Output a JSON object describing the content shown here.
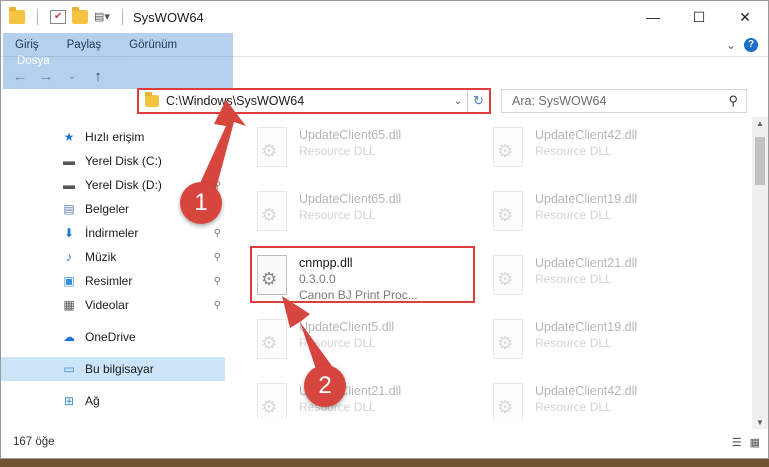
{
  "window": {
    "title": "SysWOW64",
    "controls": {
      "minimize": "—",
      "maximize": "☐",
      "close": "✕"
    }
  },
  "ribbon": {
    "tabs": [
      "Dosya",
      "Giriş",
      "Paylaş",
      "Görünüm"
    ],
    "expand": "⌄",
    "help": "?"
  },
  "navbar": {
    "back": "←",
    "forward": "→",
    "recent": "⌄",
    "up": "↑",
    "address": "C:\\Windows\\SysWOW64",
    "dropdown": "⌄",
    "refresh": "↻",
    "search_placeholder": "Ara: SysWOW64",
    "search_icon": "⚲"
  },
  "sidebar": {
    "items": [
      {
        "label": "Hızlı erişim",
        "icon": "star-icon",
        "glyph": "★",
        "color": "#1e73d6",
        "pinned": false
      },
      {
        "label": "Yerel Disk (C:)",
        "icon": "drive-icon",
        "glyph": "▬",
        "color": "#555555",
        "pinned": true
      },
      {
        "label": "Yerel Disk (D:)",
        "icon": "drive-icon",
        "glyph": "▬",
        "color": "#555555",
        "pinned": true
      },
      {
        "label": "Belgeler",
        "icon": "document-icon",
        "glyph": "▤",
        "color": "#5a7fb0",
        "pinned": true
      },
      {
        "label": "İndirmeler",
        "icon": "download-icon",
        "glyph": "⬇",
        "color": "#1e73d6",
        "pinned": true
      },
      {
        "label": "Müzik",
        "icon": "music-icon",
        "glyph": "♪",
        "color": "#1e73d6",
        "pinned": true
      },
      {
        "label": "Resimler",
        "icon": "pictures-icon",
        "glyph": "▣",
        "color": "#3a8dd8",
        "pinned": true
      },
      {
        "label": "Videolar",
        "icon": "video-icon",
        "glyph": "▦",
        "color": "#555555",
        "pinned": true
      }
    ],
    "onedrive": {
      "label": "OneDrive",
      "icon": "cloud-icon",
      "glyph": "☁",
      "color": "#1e73d6"
    },
    "computer": {
      "label": "Bu bilgisayar",
      "icon": "computer-icon",
      "glyph": "▭",
      "color": "#3a8dd8"
    },
    "network": {
      "label": "Ağ",
      "icon": "network-icon",
      "glyph": "⊞",
      "color": "#3a8dd8"
    },
    "pin_glyph": "📌"
  },
  "files": [
    {
      "name": "UpdateClient65.dll",
      "desc": "Resource DLL"
    },
    {
      "name": "UpdateClient42.dll",
      "desc": "Resource DLL"
    },
    {
      "name": "UpdateClient65.dll",
      "desc": "Resource DLL"
    },
    {
      "name": "UpdateClient19.dll",
      "desc": "Resource DLL"
    },
    {
      "name": "cnmpp.dll",
      "version": "0.3.0.0",
      "desc": "Canon BJ Print Proc...",
      "highlighted": true
    },
    {
      "name": "UpdateClient21.dll",
      "desc": "Resource DLL"
    },
    {
      "name": "UpdateClient5.dll",
      "desc": "Resource DLL"
    },
    {
      "name": "UpdateClient19.dll",
      "desc": "Resource DLL"
    },
    {
      "name": "UpdateClient21.dll",
      "desc": "Resource DLL"
    },
    {
      "name": "UpdateClient42.dll",
      "desc": "Resource DLL"
    }
  ],
  "status": {
    "count": "167 öğe",
    "details_view": "☰",
    "icons_view": "▦"
  },
  "markers": [
    {
      "label": "1"
    },
    {
      "label": "2"
    }
  ],
  "colors": {
    "accent": "#1a6fc9",
    "highlight": "#e03c3c",
    "marker": "#d6463f",
    "selected": "#cce4f7"
  }
}
